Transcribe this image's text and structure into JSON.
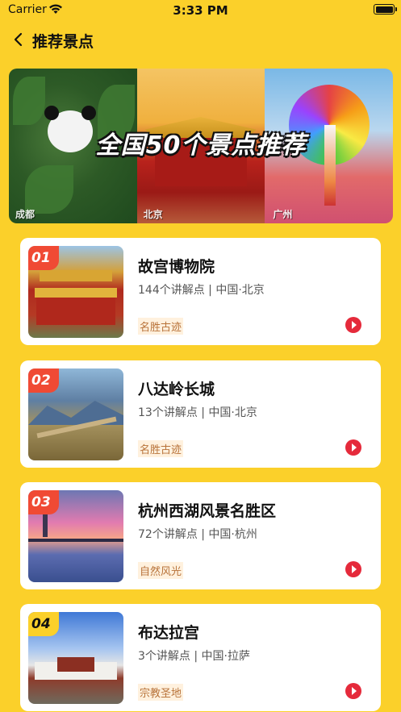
{
  "status": {
    "carrier": "Carrier",
    "time": "3:33 PM"
  },
  "nav": {
    "title": "推荐景点"
  },
  "banner": {
    "headline": "全国50个景点推荐",
    "cities": [
      "成都",
      "北京",
      "广州"
    ]
  },
  "spots": [
    {
      "rank": "01",
      "name": "故宫博物院",
      "meta": "144个讲解点 | 中国·北京",
      "tag": "名胜古迹",
      "badge_color": "#F04A34"
    },
    {
      "rank": "02",
      "name": "八达岭长城",
      "meta": "13个讲解点 | 中国·北京",
      "tag": "名胜古迹",
      "badge_color": "#F04A34"
    },
    {
      "rank": "03",
      "name": "杭州西湖风景名胜区",
      "meta": "72个讲解点 | 中国·杭州",
      "tag": "自然风光",
      "badge_color": "#F04A34"
    },
    {
      "rank": "04",
      "name": "布达拉宫",
      "meta": "3个讲解点 | 中国·拉萨",
      "tag": "宗教圣地",
      "badge_color": "#FBD02A"
    }
  ],
  "colors": {
    "background": "#FBD02A",
    "play": "#E52A3B",
    "tag_text": "#B8733A"
  }
}
